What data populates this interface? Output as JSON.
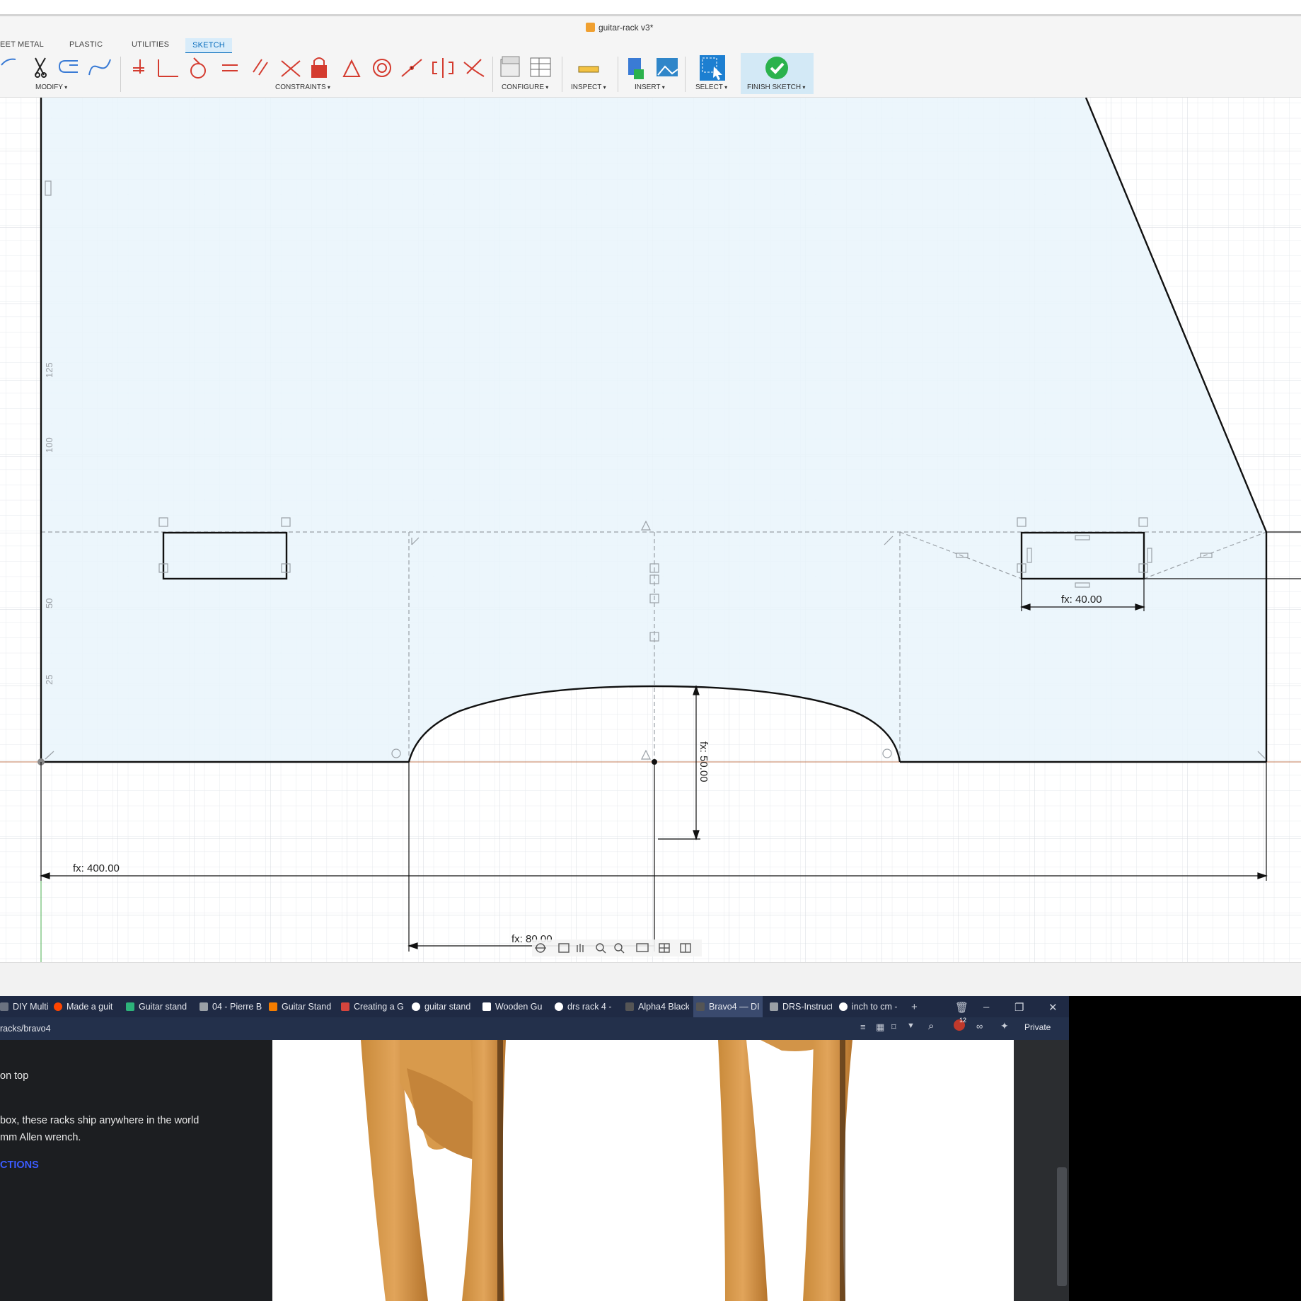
{
  "app": {
    "document_title": "guitar-rack v3*",
    "tabs": [
      "EET METAL",
      "PLASTIC",
      "UTILITIES",
      "SKETCH"
    ],
    "active_tab": "SKETCH",
    "toolbar_groups": {
      "modify": "MODIFY",
      "constraints": "CONSTRAINTS",
      "configure": "CONFIGURE",
      "inspect": "INSPECT",
      "insert": "INSERT",
      "select": "SELECT",
      "finish": "FINISH SKETCH"
    },
    "accent_color": "#0a6ebd",
    "finish_color": "#2bb24c"
  },
  "sketch": {
    "ruler_labels": [
      "125",
      "100",
      "50",
      "25"
    ],
    "dimensions": {
      "total_width": "fx: 400.00",
      "slot_width": "fx: 40.00",
      "arc_height": "fx: 50.00",
      "half_span": "fx: 80.00"
    },
    "fill_color": "#e9f4fb",
    "line_color": "#111111"
  },
  "browser": {
    "tabs": [
      {
        "label": "DIY Multi Gu",
        "icon": "page-icon",
        "color": "#6b7280"
      },
      {
        "label": "Made a guit",
        "icon": "reddit-icon",
        "color": "#ff4500"
      },
      {
        "label": "Guitar stand",
        "icon": "site-icon",
        "color": "#2db37a"
      },
      {
        "label": "04 - Pierre B",
        "icon": "page-icon",
        "color": "#9aa0a6"
      },
      {
        "label": "Guitar Stand",
        "icon": "blogger-icon",
        "color": "#f57d00"
      },
      {
        "label": "Creating a G",
        "icon": "autodesk-icon",
        "color": "#d6453d"
      },
      {
        "label": "guitar stand",
        "icon": "google-icon",
        "color": "#ffffff"
      },
      {
        "label": "Wooden Gu",
        "icon": "instructables-icon",
        "color": "#ffffff"
      },
      {
        "label": "drs rack 4 - ",
        "icon": "google-icon",
        "color": "#ffffff"
      },
      {
        "label": "Alpha4 Black",
        "icon": "drs-icon",
        "color": "#555555"
      },
      {
        "label": "Bravo4 — DI",
        "icon": "drs-icon",
        "color": "#555555"
      },
      {
        "label": "DRS-Instruct",
        "icon": "page-icon",
        "color": "#9aa0a6"
      },
      {
        "label": "inch to cm -",
        "icon": "google-icon",
        "color": "#ffffff"
      }
    ],
    "active_tab_index": 10,
    "url": "racks/bravo4",
    "private_label": "Private",
    "badge_count": "12",
    "page": {
      "line1": "on top",
      "line2": "box, these racks ship anywhere in the world",
      "line3": "mm Allen wrench.",
      "link": "CTIONS"
    }
  }
}
